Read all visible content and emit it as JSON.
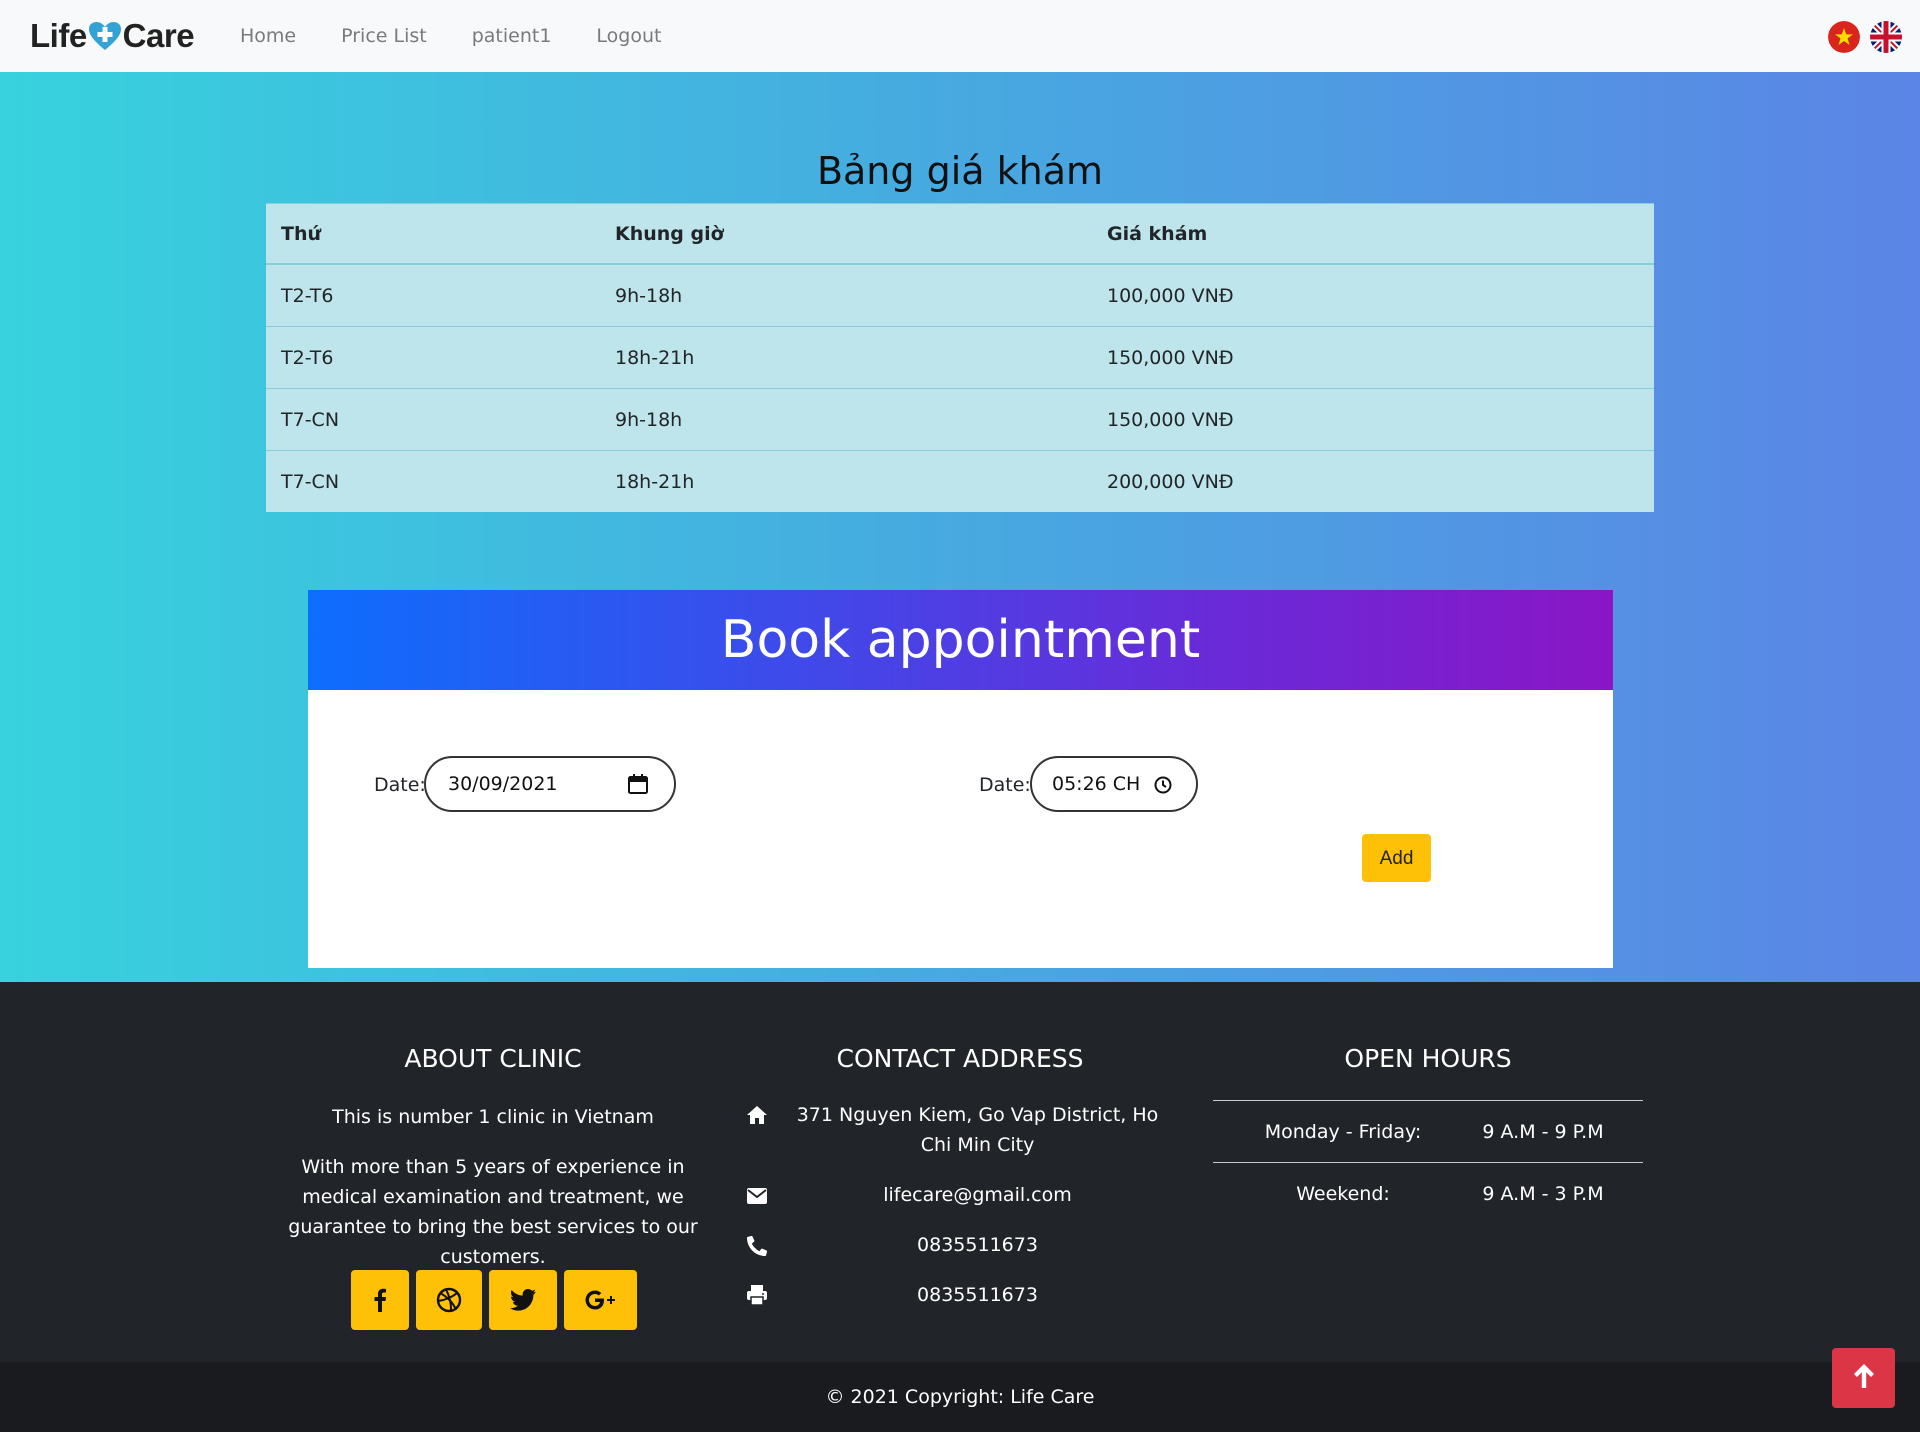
{
  "navbar": {
    "brand_left": "Life",
    "brand_right": "Care",
    "links": [
      "Home",
      "Price List",
      "patient1",
      "Logout"
    ],
    "flags": [
      "vietnam-flag-icon",
      "uk-flag-icon"
    ]
  },
  "price": {
    "title": "Bảng giá khám",
    "headers": [
      "Thứ",
      "Khung giờ",
      "Giá khám"
    ],
    "rows": [
      [
        "T2-T6",
        "9h-18h",
        "100,000 VNĐ"
      ],
      [
        "T2-T6",
        "18h-21h",
        "150,000 VNĐ"
      ],
      [
        "T7-CN",
        "9h-18h",
        "150,000 VNĐ"
      ],
      [
        "T7-CN",
        "18h-21h",
        "200,000 VNĐ"
      ]
    ]
  },
  "booking": {
    "title": "Book appointment",
    "date_label": "Date:",
    "date_value": "30/09/2021",
    "time_label": "Date:",
    "time_value": "05:26 CH",
    "add_label": "Add"
  },
  "footer": {
    "about": {
      "title": "ABOUT CLINIC",
      "line1": "This is number 1 clinic in Vietnam",
      "line2": "With more than 5 years of experience in medical examination and treatment, we guarantee to bring the best services to our customers."
    },
    "contact": {
      "title": "CONTACT ADDRESS",
      "address": "371 Nguyen Kiem, Go Vap District, Ho Chi Min City",
      "email": "lifecare@gmail.com",
      "phone": "0835511673",
      "fax": "0835511673"
    },
    "hours": {
      "title": "OPEN HOURS",
      "rows": [
        [
          "Monday - Friday:",
          "9 A.M - 9 P.M"
        ],
        [
          "Weekend:",
          "9 A.M - 3 P.M"
        ]
      ]
    },
    "social": [
      "facebook-icon",
      "dribbble-icon",
      "twitter-icon",
      "google-plus-icon"
    ],
    "copyright": "© 2021 Copyright: Life Care"
  },
  "colors": {
    "accent_yellow": "#ffc107",
    "footer_bg": "#212529",
    "back_to_top": "#dc3545",
    "gradient_start": "#37d2de",
    "gradient_end": "#5b85e6"
  }
}
